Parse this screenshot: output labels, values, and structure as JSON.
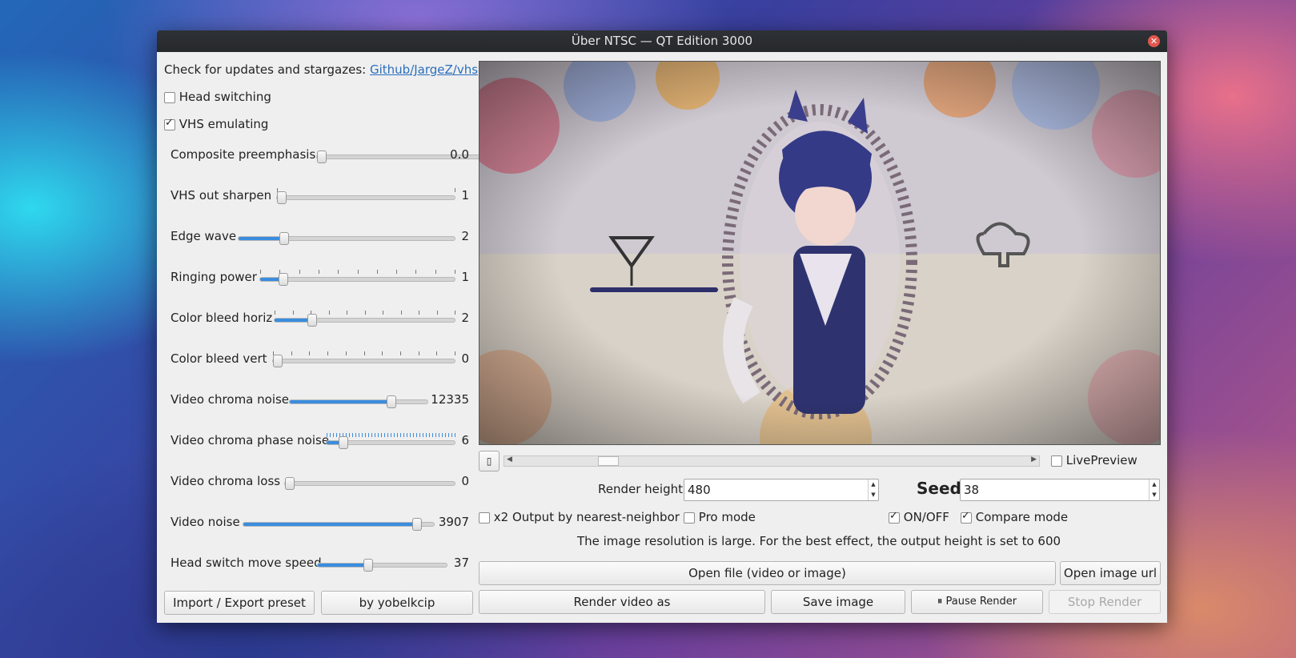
{
  "window": {
    "title": "Über NTSC — QT Edition 3000"
  },
  "updates": {
    "text": "Check for updates and stargazes:",
    "link": "Github/JargeZ/vhs"
  },
  "checkboxes": {
    "head_switching": {
      "label": "Head switching",
      "checked": false
    },
    "vhs_emulating": {
      "label": "VHS emulating",
      "checked": true
    }
  },
  "sliders": [
    {
      "label": "Composite preemphasis",
      "value": "0.0",
      "fraction": 0.0
    },
    {
      "label": "VHS out sharpen",
      "value": "1",
      "fraction": 0.0
    },
    {
      "label": "Edge wave",
      "value": "2",
      "fraction": 0.21
    },
    {
      "label": "Ringing power",
      "value": "1",
      "fraction": 0.12
    },
    {
      "label": "Color bleed horiz",
      "value": "2",
      "fraction": 0.21
    },
    {
      "label": "Color bleed vert",
      "value": "0",
      "fraction": 0.0
    },
    {
      "label": "Video chroma noise",
      "value": "12335",
      "fraction": 0.74
    },
    {
      "label": "Video chroma phase noise",
      "value": "6",
      "fraction": 0.13
    },
    {
      "label": "Video chroma loss",
      "value": "0",
      "fraction": 0.0
    },
    {
      "label": "Video noise",
      "value": "3907",
      "fraction": 0.91
    },
    {
      "label": "Head switch move speed",
      "value": "37",
      "fraction": 0.39
    }
  ],
  "left_buttons": {
    "import_export": "Import / Export preset",
    "author": "by yobelkcip"
  },
  "preview": {
    "scrub_button_icon": "pause-square-icon",
    "live_preview_label": "LivePreview",
    "live_preview_checked": false
  },
  "render_height": {
    "label": "Render height",
    "value": "480"
  },
  "seed": {
    "label": "Seed",
    "value": "38"
  },
  "options": {
    "x2_output": {
      "label": "x2 Output by nearest-neighbor",
      "checked": false
    },
    "pro_mode": {
      "label": "Pro mode",
      "checked": false
    },
    "on_off": {
      "label": "ON/OFF",
      "checked": true
    },
    "compare_mode": {
      "label": "Compare mode",
      "checked": true
    }
  },
  "status": {
    "message": "The image resolution is large. For the best effect, the output height is set to 600"
  },
  "buttons": {
    "open_file": "Open file (video or image)",
    "open_image_url": "Open image url",
    "render_video": "Render video as",
    "save_image": "Save image",
    "pause_render": "⏸ Pause Render",
    "stop_render": "Stop Render"
  }
}
